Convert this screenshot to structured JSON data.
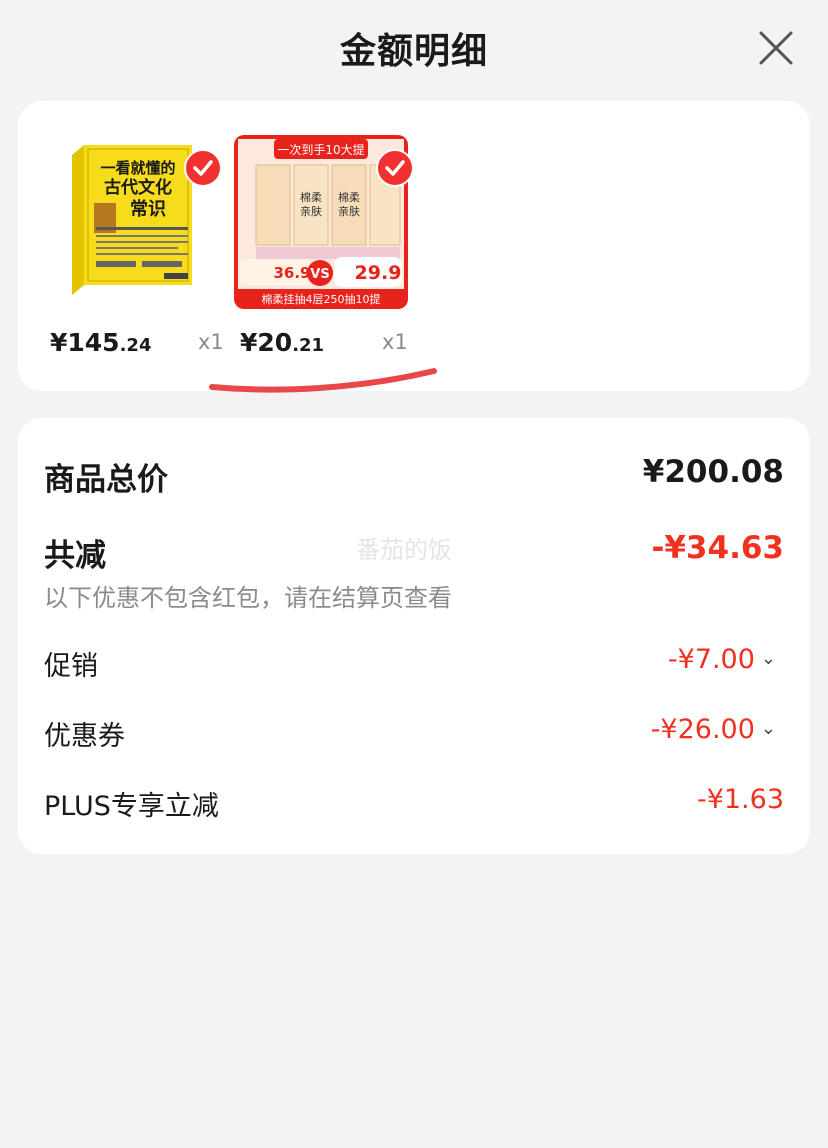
{
  "header": {
    "title": "金额明细",
    "close_icon": "close-icon"
  },
  "products": [
    {
      "name": "一看就懂的古代文化常识",
      "price_int": "¥145",
      "price_dec": ".24",
      "qty": "x1",
      "checked": true
    },
    {
      "name": "棉柔亲肤 挂抽纸巾",
      "price_int": "¥20",
      "price_dec": ".21",
      "qty": "x1",
      "checked": true
    }
  ],
  "product_images": {
    "book_lines": [
      "一看就懂的",
      "古代文化",
      "常识"
    ],
    "tissue_banner": "一次到手10大提",
    "tissue_text": [
      "棉柔",
      "亲肤"
    ],
    "tissue_prices": [
      "36.9",
      "29.9"
    ],
    "tissue_footer": "棉柔挂抽4层250抽10提"
  },
  "summary": {
    "total_label": "商品总价",
    "total_value": "¥200.08",
    "discount_label": "共减",
    "discount_value": "-¥34.63",
    "note": "以下优惠不包含红包，请在结算页查看",
    "watermark": "番茄的饭",
    "items": [
      {
        "label": "促销",
        "value": "-¥7.00",
        "expandable": true
      },
      {
        "label": "优惠券",
        "value": "-¥26.00",
        "expandable": true
      },
      {
        "label": "PLUS专享立减",
        "value": "-¥1.63",
        "expandable": false
      }
    ]
  },
  "colors": {
    "accent_red": "#f0311f",
    "background": "#f3f3f3",
    "card": "#ffffff",
    "underline": "#e8484a"
  }
}
